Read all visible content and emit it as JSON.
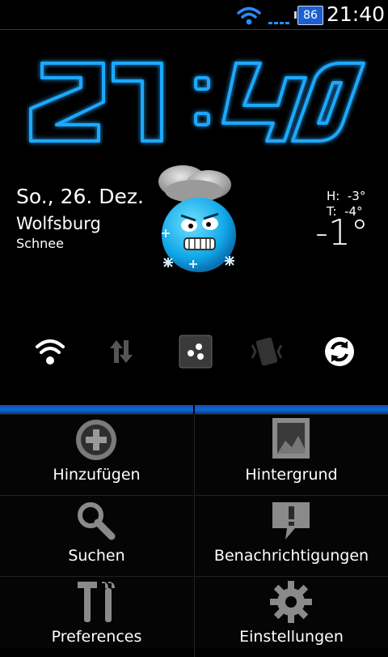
{
  "status_bar": {
    "battery_level": "86",
    "time": "21:40",
    "icons": [
      "wifi-icon",
      "signal-icon",
      "battery-icon"
    ]
  },
  "clock": {
    "time": "21:40",
    "color": "#1aa8ff"
  },
  "weather": {
    "date": "So., 26. Dez.",
    "city": "Wolfsburg",
    "condition": "Schnee",
    "high": "H:  -3°",
    "low": "T:  -4°",
    "current_temp": "-1°",
    "icon": "snow-weather-icon"
  },
  "toggles": [
    {
      "name": "wifi-toggle",
      "icon": "wifi-icon",
      "state": "on"
    },
    {
      "name": "data-toggle",
      "icon": "mobile-data-icon",
      "state": "off"
    },
    {
      "name": "bluetooth-toggle",
      "icon": "bluetooth-icon",
      "state": "on"
    },
    {
      "name": "vibrate-toggle",
      "icon": "vibrate-icon",
      "state": "off"
    },
    {
      "name": "sync-toggle",
      "icon": "sync-icon",
      "state": "on"
    }
  ],
  "menu": {
    "items": [
      {
        "label": "Hinzufügen",
        "icon": "add-icon"
      },
      {
        "label": "Hintergrund",
        "icon": "wallpaper-icon"
      },
      {
        "label": "Suchen",
        "icon": "search-icon"
      },
      {
        "label": "Benachrichtigungen",
        "icon": "notifications-icon"
      },
      {
        "label": "Preferences",
        "icon": "tools-icon"
      },
      {
        "label": "Einstellungen",
        "icon": "settings-gear-icon"
      }
    ]
  },
  "colors": {
    "accent": "#0a67df",
    "clock_glow": "#1aa8ff",
    "background": "#000000"
  }
}
